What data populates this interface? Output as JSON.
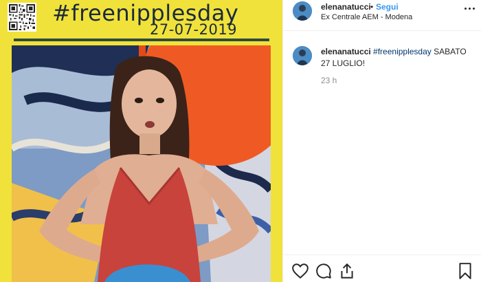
{
  "poster": {
    "hashtag": "#freenipplesday",
    "date": "27-07-2019"
  },
  "header": {
    "username": "elenanatucci",
    "separator": "•",
    "follow_label": "Segui",
    "location": "Ex Centrale AEM - Modena"
  },
  "caption": {
    "username": "elenanatucci",
    "hashtag": "#freenipplesday",
    "text": " SABATO 27 LUGLIO!"
  },
  "time_ago": "23 h",
  "icons": {
    "qr": "qr-code-icon",
    "more": "more-options-icon",
    "like": "heart-icon",
    "comment": "comment-icon",
    "share": "share-icon",
    "save": "bookmark-icon"
  },
  "colors": {
    "poster_yellow": "#f0e23a",
    "follow_blue": "#3897f0",
    "hashtag_blue": "#003569"
  }
}
